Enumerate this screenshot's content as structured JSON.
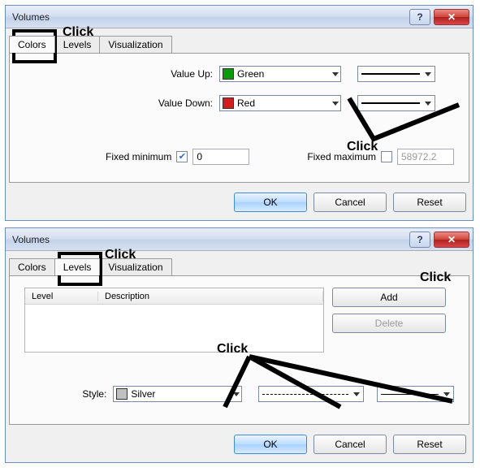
{
  "annotations": {
    "click": "Click"
  },
  "dialog1": {
    "title": "Volumes",
    "tabs": {
      "colors": "Colors",
      "levels": "Levels",
      "visualization": "Visualization"
    },
    "value_up_label": "Value Up:",
    "value_up_color": {
      "name": "Green",
      "hex": "#0a9b0a"
    },
    "value_down_label": "Value Down:",
    "value_down_color": {
      "name": "Red",
      "hex": "#d21e1e"
    },
    "fixed_min_label": "Fixed minimum",
    "fixed_min_checked": true,
    "fixed_min_value": "0",
    "fixed_max_label": "Fixed maximum",
    "fixed_max_checked": false,
    "fixed_max_value": "58972.2",
    "buttons": {
      "ok": "OK",
      "cancel": "Cancel",
      "reset": "Reset"
    }
  },
  "dialog2": {
    "title": "Volumes",
    "tabs": {
      "colors": "Colors",
      "levels": "Levels",
      "visualization": "Visualization"
    },
    "table": {
      "col_level": "Level",
      "col_description": "Description"
    },
    "add_label": "Add",
    "delete_label": "Delete",
    "style_label": "Style:",
    "style_color": {
      "name": "Silver",
      "hex": "#c0c0c0"
    },
    "buttons": {
      "ok": "OK",
      "cancel": "Cancel",
      "reset": "Reset"
    }
  }
}
